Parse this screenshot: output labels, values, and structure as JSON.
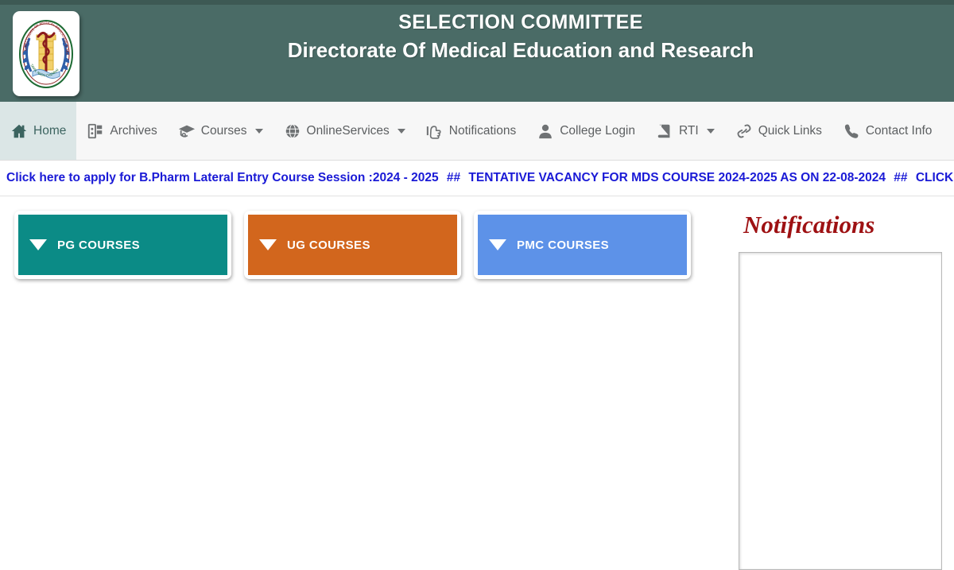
{
  "site": {
    "title_main": "SELECTION COMMITTEE",
    "title_sub": "Directorate Of Medical Education and Research",
    "logo_alt": "dmer-emblem",
    "header_bg": "#4a6b66",
    "topstrip_bg": "#3d5954"
  },
  "nav": {
    "items": [
      {
        "label": "Home",
        "icon": "home-icon",
        "caret": false,
        "active": true
      },
      {
        "label": "Archives",
        "icon": "archive-icon",
        "caret": false,
        "active": false
      },
      {
        "label": "Courses",
        "icon": "graduation-cap-icon",
        "caret": true,
        "active": false
      },
      {
        "label": "OnlineServices",
        "icon": "globe-icon",
        "caret": true,
        "active": false
      },
      {
        "label": "Notifications",
        "icon": "pointing-hand-icon",
        "caret": false,
        "active": false
      },
      {
        "label": "College Login",
        "icon": "user-icon",
        "caret": false,
        "active": false
      },
      {
        "label": "RTI",
        "icon": "book-icon",
        "caret": true,
        "active": false
      },
      {
        "label": "Quick Links",
        "icon": "chain-link-icon",
        "caret": false,
        "active": false
      },
      {
        "label": "Contact Info",
        "icon": "phone-icon",
        "caret": false,
        "active": false
      }
    ],
    "active_bg": "#dbe6e6"
  },
  "ticker": {
    "color": "#1a1ad6",
    "separator": "##",
    "messages": [
      "Click here to apply for B.Pharm Lateral Entry Course Session :2024 - 2025",
      "TENTATIVE VACANCY FOR MDS COURSE 2024-2025 AS ON 22-08-2024",
      "CLICK HERE FOR ONLINE C"
    ]
  },
  "courses": {
    "cards": [
      {
        "label": "PG COURSES",
        "color": "#0b8b86",
        "icon": "triangle-down-icon"
      },
      {
        "label": "UG COURSES",
        "color": "#d2661d",
        "icon": "triangle-down-icon"
      },
      {
        "label": "PMC COURSES",
        "color": "#5d92e8",
        "icon": "triangle-down-icon"
      }
    ]
  },
  "notifications": {
    "title": "Notifications",
    "title_color": "#9e1113",
    "items": []
  }
}
